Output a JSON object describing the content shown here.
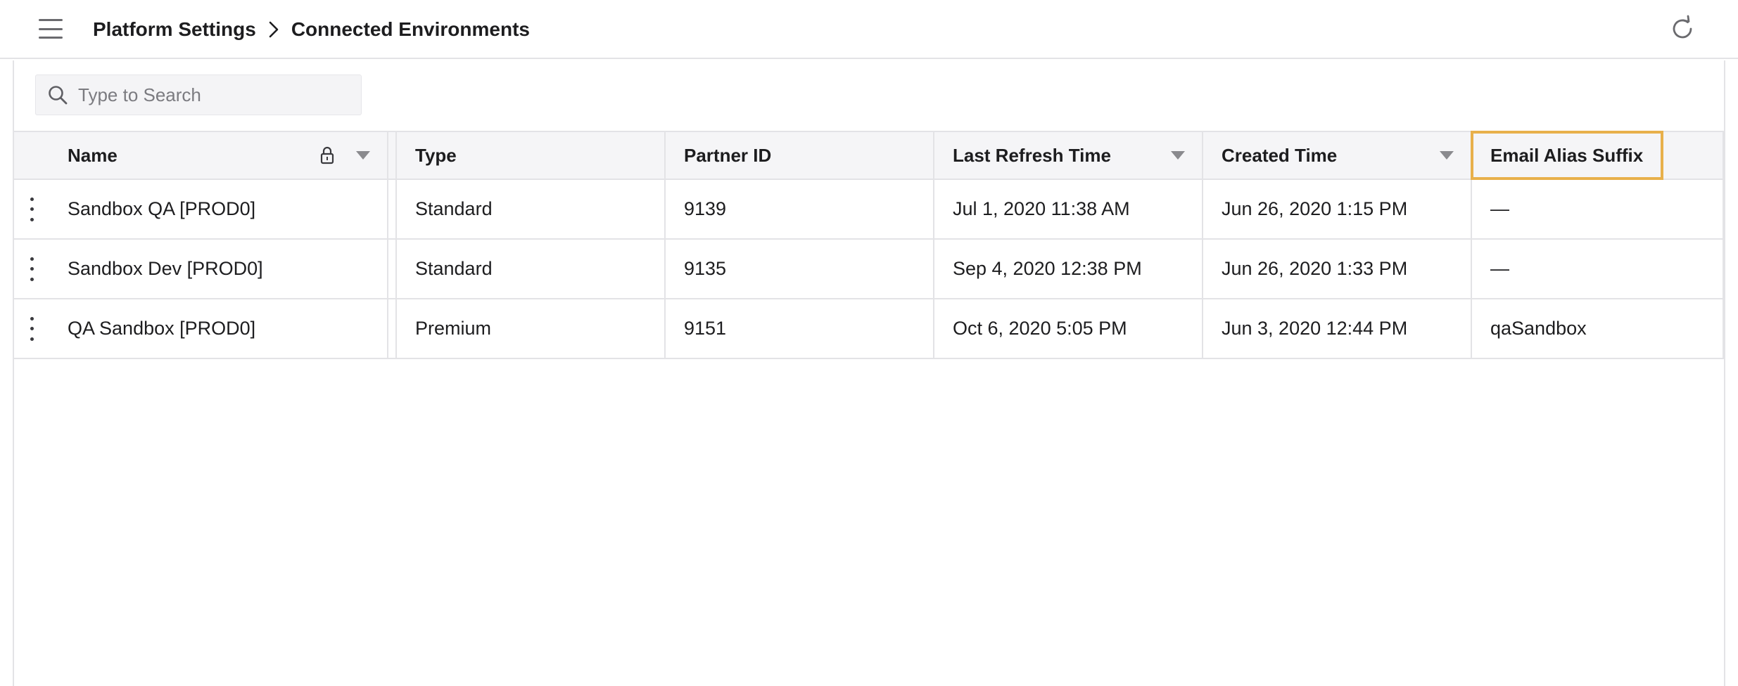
{
  "header": {
    "breadcrumb": [
      "Platform Settings",
      "Connected Environments"
    ],
    "menu_icon": "hamburger-menu-icon",
    "refresh_icon": "refresh-icon"
  },
  "search": {
    "placeholder": "Type to Search",
    "value": ""
  },
  "table": {
    "columns": {
      "name": "Name",
      "type": "Type",
      "partner_id": "Partner ID",
      "last_refresh": "Last Refresh Time",
      "created": "Created Time",
      "email_alias": "Email Alias Suffix"
    },
    "highlighted_column_color": "#e8b04b",
    "rows": [
      {
        "name": "Sandbox QA [PROD0]",
        "type": "Standard",
        "partner_id": "9139",
        "last_refresh": "Jul 1, 2020 11:38 AM",
        "created": "Jun 26, 2020 1:15 PM",
        "email_alias": "—"
      },
      {
        "name": "Sandbox Dev [PROD0]",
        "type": "Standard",
        "partner_id": "9135",
        "last_refresh": "Sep 4, 2020 12:38 PM",
        "created": "Jun 26, 2020 1:33 PM",
        "email_alias": "—"
      },
      {
        "name": "QA Sandbox [PROD0]",
        "type": "Premium",
        "partner_id": "9151",
        "last_refresh": "Oct 6, 2020 5:05 PM",
        "created": "Jun 3, 2020 12:44 PM",
        "email_alias": "qaSandbox"
      }
    ]
  }
}
